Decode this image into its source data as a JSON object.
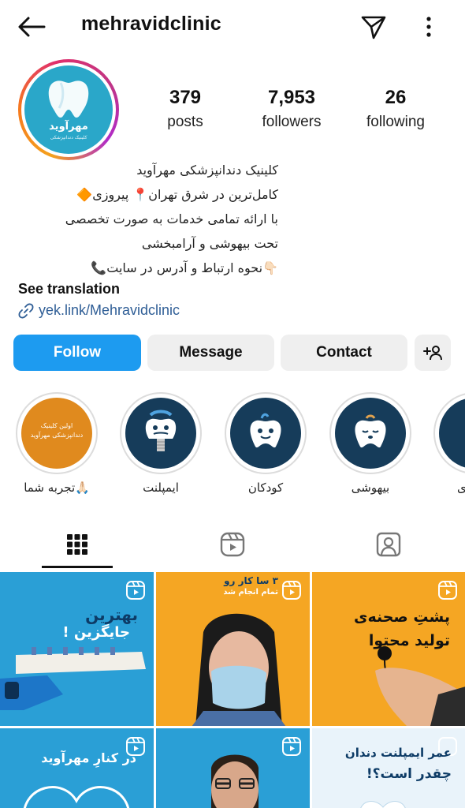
{
  "header": {
    "username": "mehravidclinic",
    "back_icon": "arrow-left-icon",
    "send_icon": "send-icon",
    "more_icon": "more-vertical-icon"
  },
  "profile": {
    "avatar_brand": "مهرآوید",
    "avatar_sub": "کلینیک دندانپزشکی",
    "stats": [
      {
        "value": "379",
        "label": "posts"
      },
      {
        "value": "7,953",
        "label": "followers"
      },
      {
        "value": "26",
        "label": "following"
      }
    ],
    "bio_lines": [
      "کلینیک دندانپزشکی مهرآوید",
      "کامل‌ترین در شرق تهران📍 پیروزی🔶",
      "با ارائه تمامی خدمات به صورت تخصصی",
      "تحت بیهوشی و آرامبخشی",
      "👇🏻نحوه ارتباط و آدرس در سایت📞"
    ],
    "see_translation": "See translation",
    "link": "yek.link/Mehravidclinic"
  },
  "actions": {
    "follow": "Follow",
    "message": "Message",
    "contact": "Contact"
  },
  "highlights": [
    {
      "label": "تجربه شما🙏🏻",
      "cover_text": "اولین کلینیک دندانپزشکی مهرآوید"
    },
    {
      "label": "ایمپلنت"
    },
    {
      "label": "کودکان"
    },
    {
      "label": "بیهوشی"
    },
    {
      "label": "ی"
    }
  ],
  "tabs": [
    "grid-icon",
    "reels-icon",
    "tagged-icon"
  ],
  "posts": [
    {
      "title": "بهترین",
      "subtitle": "جایگزین !"
    },
    {
      "title": "۳ سا کار رو",
      "subtitle": "تمام انجام شد"
    },
    {
      "title": "پشتِ صحنه‌ی",
      "subtitle": "تولید محتوا"
    },
    {
      "title": "در کنارِ مهرآوید"
    },
    {
      "title": ""
    },
    {
      "title": "عمر ایمپلنت دندان",
      "subtitle": "چقدر است؟!"
    }
  ],
  "colors": {
    "follow_blue": "#1d9bf0",
    "link_blue": "#2f5e96",
    "brand_teal": "#2aa7c9",
    "post_blue": "#2a9fd6",
    "post_orange": "#f5a623"
  }
}
